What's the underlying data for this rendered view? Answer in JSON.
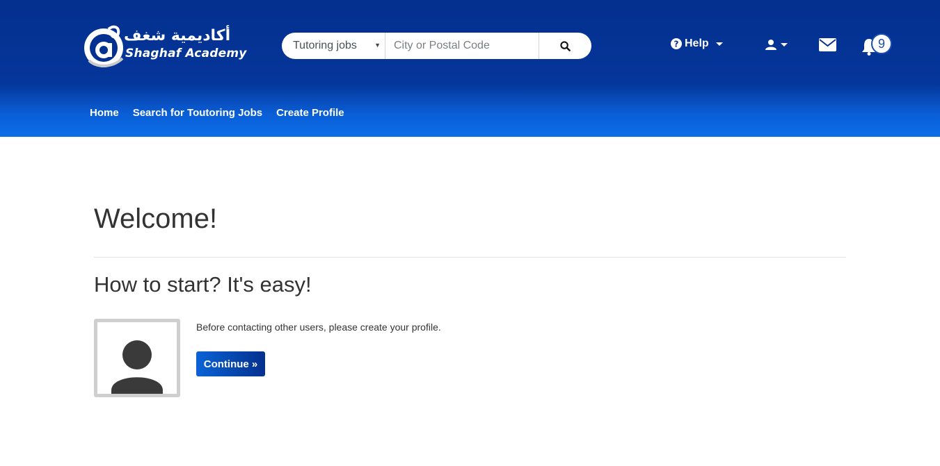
{
  "brand": {
    "arabic_name": "أكاديمية شغف",
    "latin_name": "Shaghaf Academy"
  },
  "search": {
    "category_value": "Tutoring jobs",
    "location_placeholder": "City or Postal Code",
    "button_icon": "search-icon"
  },
  "header_actions": {
    "help_label": "Help",
    "user_icon": "user-icon",
    "mail_icon": "envelope-icon",
    "bell_icon": "bell-icon",
    "notification_count": "9"
  },
  "nav": {
    "items": [
      "Home",
      "Search for Toutoring Jobs",
      "Create Profile"
    ]
  },
  "main": {
    "title": "Welcome!",
    "subtitle": "How to start? It's easy!",
    "intro_text": "Before contacting other users, please create your profile.",
    "continue_label": "Continue »",
    "avatar_icon": "user-placeholder-icon"
  },
  "colors": {
    "header_dark": "#04308f",
    "header_light": "#0b6ee8",
    "text": "#333333",
    "badge_border": "#1a4db3"
  }
}
